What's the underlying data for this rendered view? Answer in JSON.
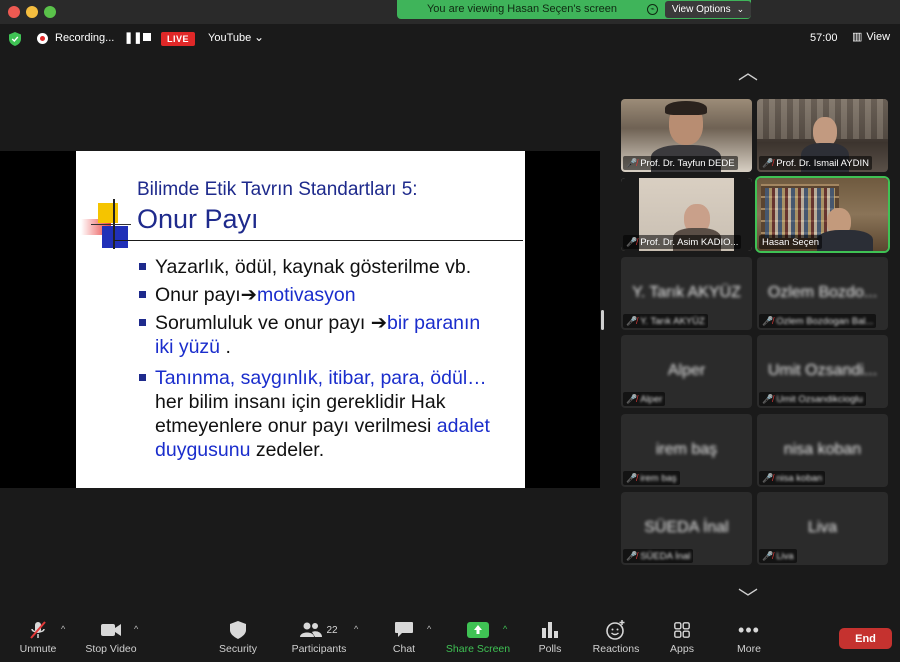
{
  "window": {
    "banner_text": "You are viewing Hasan Seçen's screen",
    "view_options_label": "View Options",
    "traffic_colors": [
      "#ee5a52",
      "#f5be3f",
      "#5ac24a"
    ]
  },
  "topbar": {
    "recording_label": "Recording...",
    "live_label": "LIVE",
    "stream_target": "YouTube",
    "timer": "57:00",
    "view_label": "View"
  },
  "slide": {
    "subtitle": "Bilimde Etik Tavrın Standartları 5:",
    "title": "Onur Payı",
    "bullets": [
      {
        "text": "Yazarlık, ödül, kaynak gösterilme vb."
      },
      {
        "prefix": "Onur payı",
        "highlight": "motivasyon"
      },
      {
        "prefix": "Sorumluluk ve onur payı ",
        "highlight": "bir paranın",
        "line2_highlight": "iki yüzü",
        "line2_suffix": " ."
      },
      {
        "line1_highlight": "Tanınma, saygınlık, itibar, para, ödül…",
        "line2": "her bilim insanı için gereklidir Hak",
        "line3_prefix": "etmeyenlere onur payı verilmesi ",
        "line3_highlight": "adalet",
        "line4_highlight": "duygusunu",
        "line4_suffix": " zedeler."
      }
    ]
  },
  "participants_tiles": [
    {
      "name": "Prof. Dr. Tayfun DEDE",
      "muted": true,
      "video": true
    },
    {
      "name": "Prof. Dr. Ismail AYDIN",
      "muted": true,
      "video": true
    },
    {
      "name": "Prof. Dr. Asim KADIO...",
      "muted": true,
      "video": true
    },
    {
      "name": "Hasan Seçen",
      "muted": false,
      "video": true,
      "active_speaker": true
    },
    {
      "name": "Y. Tarık AKYÜZ",
      "muted": true,
      "video": false
    },
    {
      "name": "Ozlem Bozdo...",
      "small_name": "Ozlem Bozdogan Bal...",
      "muted": true,
      "video": false
    },
    {
      "name": "Alper",
      "muted": true,
      "video": false
    },
    {
      "name": "Umit Ozsandi...",
      "small_name": "Umit Ozsandikcioglu",
      "muted": true,
      "video": false
    },
    {
      "name": "irem baş",
      "muted": true,
      "video": false
    },
    {
      "name": "nisa koban",
      "muted": true,
      "video": false
    },
    {
      "name": "SÜEDA İnal",
      "muted": true,
      "video": false
    },
    {
      "name": "Liva",
      "muted": true,
      "video": false
    }
  ],
  "toolbar": {
    "unmute": "Unmute",
    "stop_video": "Stop Video",
    "security": "Security",
    "participants": "Participants",
    "participants_count": "22",
    "chat": "Chat",
    "share_screen": "Share Screen",
    "polls": "Polls",
    "reactions": "Reactions",
    "apps": "Apps",
    "more": "More",
    "end": "End",
    "accent_green": "#3fc254",
    "end_color": "#c5322f"
  }
}
